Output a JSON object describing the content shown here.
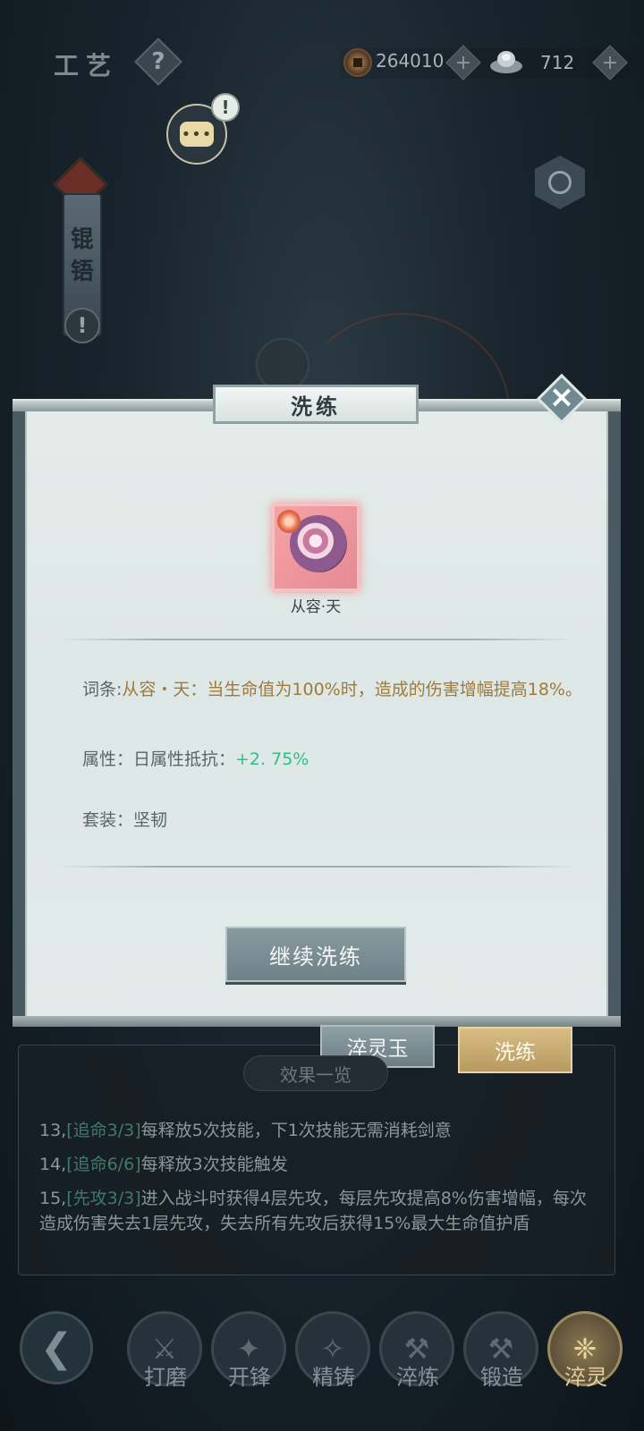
{
  "header": {
    "title": "工艺",
    "help_icon": "?",
    "copper": "264010",
    "silver": "712"
  },
  "side_banner": {
    "text": "锟铻"
  },
  "modal": {
    "title": "洗练",
    "item_name": "从容·天",
    "affix_label": "词条:",
    "affix_text": "从容・天：当生命值为100%时，造成的伤害增幅提高18%。",
    "attr_label": "属性：日属性抵抗：",
    "attr_value": "+2. 75%",
    "set_text": "套装：坚韧",
    "continue_label": "继续洗练"
  },
  "tabs": {
    "jade": "淬灵玉",
    "wash": "洗练"
  },
  "effects": {
    "title": "效果一览",
    "items": [
      {
        "num": "13,",
        "tag": "[追命3/3]",
        "text": "每释放5次技能，下1次技能无需消耗剑意"
      },
      {
        "num": "14,",
        "tag": "[追命6/6]",
        "text": "每释放3次技能触发"
      },
      {
        "num": "15,",
        "tag": "[先攻3/3]",
        "text": "进入战斗时获得4层先攻，每层先攻提高8%伤害增幅，每次造成伤害失去1层先攻，失去所有先攻后获得15%最大生命值护盾"
      }
    ]
  },
  "nav": {
    "items": [
      {
        "label": "打磨",
        "icon": "grind-icon",
        "active": false
      },
      {
        "label": "开锋",
        "icon": "sharpen-icon",
        "active": false
      },
      {
        "label": "精铸",
        "icon": "refine-cast-icon",
        "active": false
      },
      {
        "label": "淬炼",
        "icon": "temper-icon",
        "active": false
      },
      {
        "label": "锻造",
        "icon": "anvil-icon",
        "active": false
      },
      {
        "label": "淬灵",
        "icon": "spirit-temper-icon",
        "active": true
      }
    ]
  },
  "colors": {
    "affix": "#a07a38",
    "attr_value": "#2fbf86",
    "active_tab": "#d9bd84"
  }
}
